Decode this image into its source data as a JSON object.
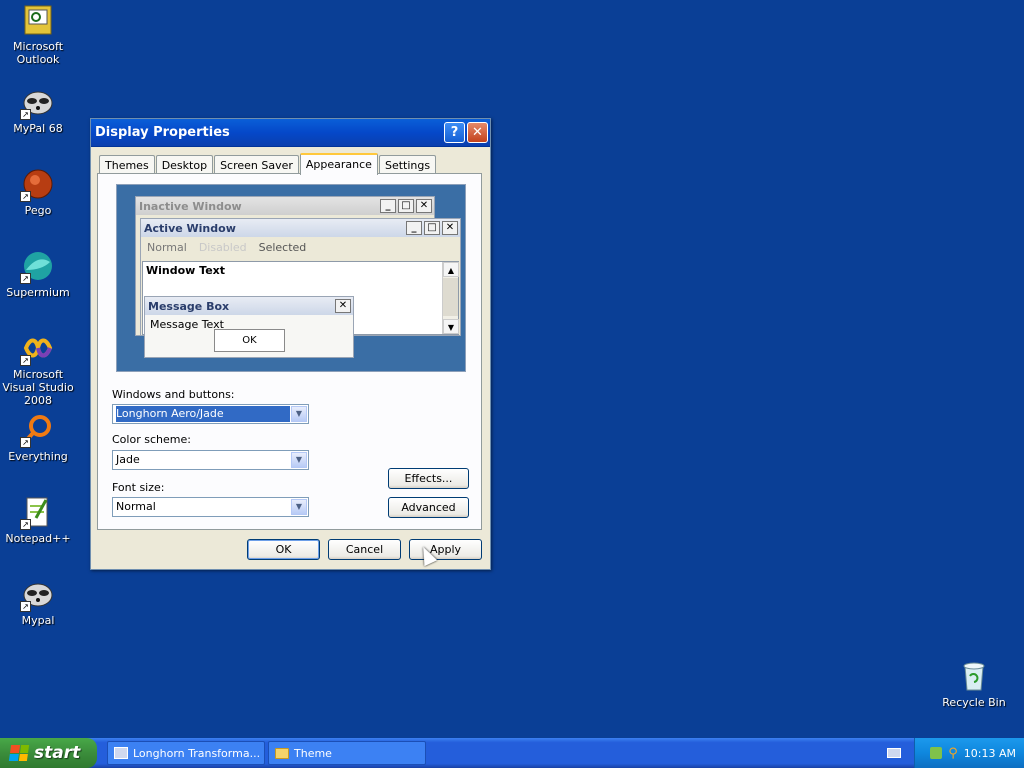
{
  "desktop": {
    "icons": [
      {
        "label": "Microsoft Outlook",
        "icon": "outlook-icon"
      },
      {
        "label": "MyPal 68",
        "icon": "mypal-icon"
      },
      {
        "label": "Pego",
        "icon": "pego-icon"
      },
      {
        "label": "Supermium",
        "icon": "supermium-icon"
      },
      {
        "label": "Microsoft Visual Studio 2008",
        "icon": "visual-studio-icon"
      },
      {
        "label": "Everything",
        "icon": "everything-icon"
      },
      {
        "label": "Notepad++",
        "icon": "notepadpp-icon"
      },
      {
        "label": "Mypal",
        "icon": "mypal-icon"
      },
      {
        "label": "Recycle Bin",
        "icon": "recycle-bin-icon"
      }
    ]
  },
  "dialog": {
    "title": "Display Properties",
    "help_glyph": "?",
    "close_glyph": "✕",
    "tabs": [
      "Themes",
      "Desktop",
      "Screen Saver",
      "Appearance",
      "Settings"
    ],
    "active_tab": "Appearance",
    "preview": {
      "inactive_title": "Inactive Window",
      "active_title": "Active Window",
      "menu_normal": "Normal",
      "menu_disabled": "Disabled",
      "menu_selected": "Selected",
      "window_text": "Window Text",
      "msgbox_title": "Message Box",
      "msgbox_text": "Message Text",
      "msgbox_ok": "OK"
    },
    "windows_buttons_label": "Windows and buttons:",
    "windows_buttons_value": "Longhorn Aero/Jade",
    "color_scheme_label": "Color scheme:",
    "color_scheme_value": "Jade",
    "font_size_label": "Font size:",
    "font_size_value": "Normal",
    "effects_button": "Effects...",
    "advanced_button": "Advanced",
    "ok_button": "OK",
    "cancel_button": "Cancel",
    "apply_button": "Apply"
  },
  "taskbar": {
    "start_label": "start",
    "tasks": [
      "Longhorn Transforma...",
      "Theme"
    ],
    "clock": "10:13 AM"
  },
  "colors": {
    "desktop": "#0a3f96",
    "titlebar": "#0548c9",
    "taskbar": "#245edb",
    "start": "#3b8d3b"
  }
}
